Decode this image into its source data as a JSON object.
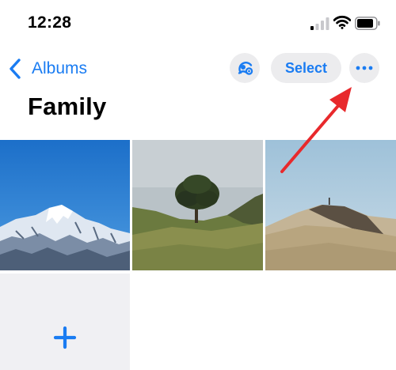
{
  "status_bar": {
    "time": "12:28"
  },
  "nav": {
    "back_label": "Albums",
    "select_label": "Select"
  },
  "album": {
    "title": "Family"
  },
  "photos": [
    {
      "subject": "snowy mountain peak"
    },
    {
      "subject": "lone tree on hill"
    },
    {
      "subject": "person on sand dune"
    }
  ],
  "colors": {
    "accent": "#1a7cf2",
    "button_bg": "#ececee",
    "annotation_arrow": "#e8292c"
  }
}
